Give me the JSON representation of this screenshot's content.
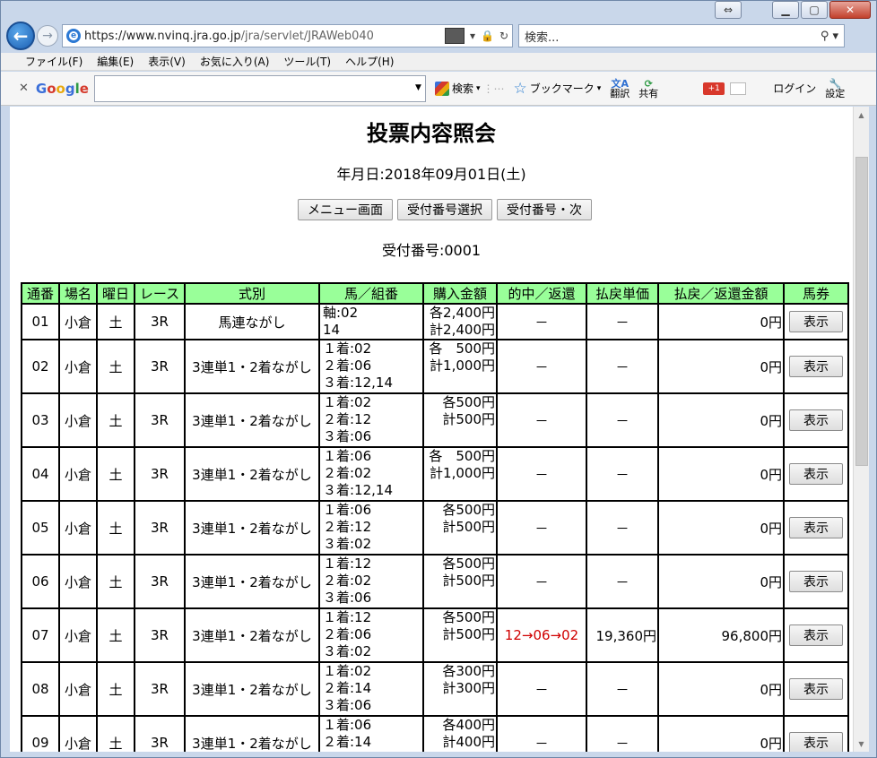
{
  "browser": {
    "url_host": "https://www.nvinq.jra.go.jp",
    "url_path": "/jra/servlet/JRAWeb040",
    "search_placeholder": "検索...",
    "menu": [
      "ファイル(F)",
      "編集(E)",
      "表示(V)",
      "お気に入り(A)",
      "ツール(T)",
      "ヘルプ(H)"
    ],
    "google_toolbar": {
      "logo": "Google",
      "search_label": "検索",
      "bookmark_label": "ブックマーク",
      "translate_label": "翻訳",
      "share_label": "共有",
      "gplus_label": "+1",
      "login_label": "ログイン",
      "settings_label": "設定"
    }
  },
  "page": {
    "title": "投票内容照会",
    "date_label": "年月日:2018年09月01日(土)",
    "buttons": {
      "menu": "メニュー画面",
      "select": "受付番号選択",
      "next": "受付番号・次"
    },
    "receipt_label": "受付番号:0001"
  },
  "table": {
    "headers": [
      "通番",
      "場名",
      "曜日",
      "レース",
      "式別",
      "馬／組番",
      "購入金額",
      "的中／返還",
      "払戻単価",
      "払戻／返還金額",
      "馬券"
    ],
    "rows": [
      {
        "no": "01",
        "place": "小倉",
        "day": "土",
        "race": "3R",
        "type": "馬連ながし",
        "horses": [
          "軸:02",
          "14"
        ],
        "amount": [
          "各2,400円",
          "計2,400円"
        ],
        "hit": "－",
        "unit": "－",
        "payout": "0円",
        "btn": "表示"
      },
      {
        "no": "02",
        "place": "小倉",
        "day": "土",
        "race": "3R",
        "type": "3連単1・2着ながし",
        "horses": [
          "１着:02",
          "２着:06",
          "３着:12,14"
        ],
        "amount": [
          "各　500円",
          "計1,000円"
        ],
        "hit": "－",
        "unit": "－",
        "payout": "0円",
        "btn": "表示"
      },
      {
        "no": "03",
        "place": "小倉",
        "day": "土",
        "race": "3R",
        "type": "3連単1・2着ながし",
        "horses": [
          "１着:02",
          "２着:12",
          "３着:06"
        ],
        "amount": [
          "各500円",
          "計500円"
        ],
        "hit": "－",
        "unit": "－",
        "payout": "0円",
        "btn": "表示"
      },
      {
        "no": "04",
        "place": "小倉",
        "day": "土",
        "race": "3R",
        "type": "3連単1・2着ながし",
        "horses": [
          "１着:06",
          "２着:02",
          "３着:12,14"
        ],
        "amount": [
          "各　500円",
          "計1,000円"
        ],
        "hit": "－",
        "unit": "－",
        "payout": "0円",
        "btn": "表示"
      },
      {
        "no": "05",
        "place": "小倉",
        "day": "土",
        "race": "3R",
        "type": "3連単1・2着ながし",
        "horses": [
          "１着:06",
          "２着:12",
          "３着:02"
        ],
        "amount": [
          "各500円",
          "計500円"
        ],
        "hit": "－",
        "unit": "－",
        "payout": "0円",
        "btn": "表示"
      },
      {
        "no": "06",
        "place": "小倉",
        "day": "土",
        "race": "3R",
        "type": "3連単1・2着ながし",
        "horses": [
          "１着:12",
          "２着:02",
          "３着:06"
        ],
        "amount": [
          "各500円",
          "計500円"
        ],
        "hit": "－",
        "unit": "－",
        "payout": "0円",
        "btn": "表示"
      },
      {
        "no": "07",
        "place": "小倉",
        "day": "土",
        "race": "3R",
        "type": "3連単1・2着ながし",
        "horses": [
          "１着:12",
          "２着:06",
          "３着:02"
        ],
        "amount": [
          "各500円",
          "計500円"
        ],
        "hit": "12→06→02",
        "unit": "19,360円",
        "payout": "96,800円",
        "btn": "表示"
      },
      {
        "no": "08",
        "place": "小倉",
        "day": "土",
        "race": "3R",
        "type": "3連単1・2着ながし",
        "horses": [
          "１着:02",
          "２着:14",
          "３着:06"
        ],
        "amount": [
          "各300円",
          "計300円"
        ],
        "hit": "－",
        "unit": "－",
        "payout": "0円",
        "btn": "表示"
      },
      {
        "no": "09",
        "place": "小倉",
        "day": "土",
        "race": "3R",
        "type": "3連単1・2着ながし",
        "horses": [
          "１着:06",
          "２着:14"
        ],
        "amount": [
          "各400円",
          "計400円"
        ],
        "hit": "－",
        "unit": "－",
        "payout": "0円",
        "btn": "表示"
      }
    ]
  },
  "colors": {
    "header_bg": "#99ff99",
    "hit_text": "#d00000"
  }
}
